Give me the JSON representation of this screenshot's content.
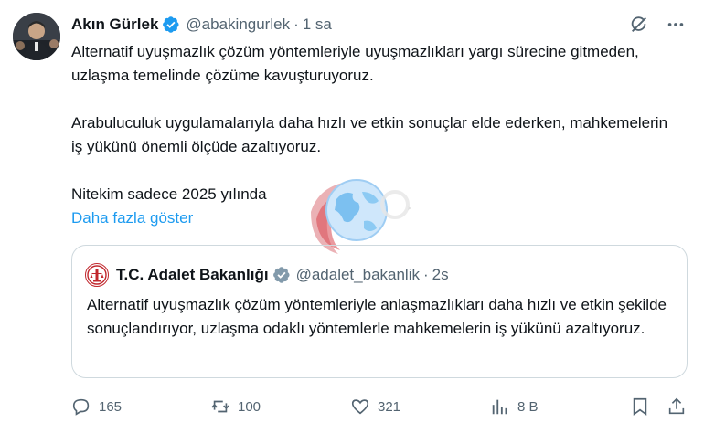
{
  "post": {
    "author_name": "Akın Gürlek",
    "author_handle": "@abakingurlek",
    "separator": "·",
    "time": "1 sa",
    "paragraphs": [
      "Alternatif uyuşmazlık çözüm yöntemleriyle uyuşmazlıkları yargı sürecine gitmeden, uzlaşma temelinde çözüme kavuşturuyoruz.",
      "Arabuluculuk uygulamalarıyla daha hızlı ve etkin sonuçlar elde ederken, mahkemelerin iş yükünü önemli ölçüde azaltıyoruz.",
      "Nitekim sadece 2025 yılında"
    ],
    "show_more": "Daha fazla göster"
  },
  "quote": {
    "author_name": "T.C. Adalet Bakanlığı",
    "author_handle": "@adalet_bakanlik",
    "separator": "·",
    "time": "2s",
    "text": "Alternatif uyuşmazlık çözüm yöntemleriyle anlaşmazlıkları daha hızlı ve etkin şekilde sonuçlandırıyor, uzlaşma odaklı yöntemlerle mahkemelerin iş yükünü azaltıyoruz."
  },
  "actions": {
    "replies": "165",
    "reposts": "100",
    "likes": "321",
    "views": "8 B"
  },
  "colors": {
    "verified": "#1d9bf0",
    "link": "#1d9bf0",
    "muted": "#536471",
    "border": "#cfd9de"
  },
  "icons": [
    "verified-badge-icon",
    "grok-icon",
    "more-icon",
    "reply-icon",
    "repost-icon",
    "like-icon",
    "views-icon",
    "bookmark-icon",
    "share-icon"
  ]
}
